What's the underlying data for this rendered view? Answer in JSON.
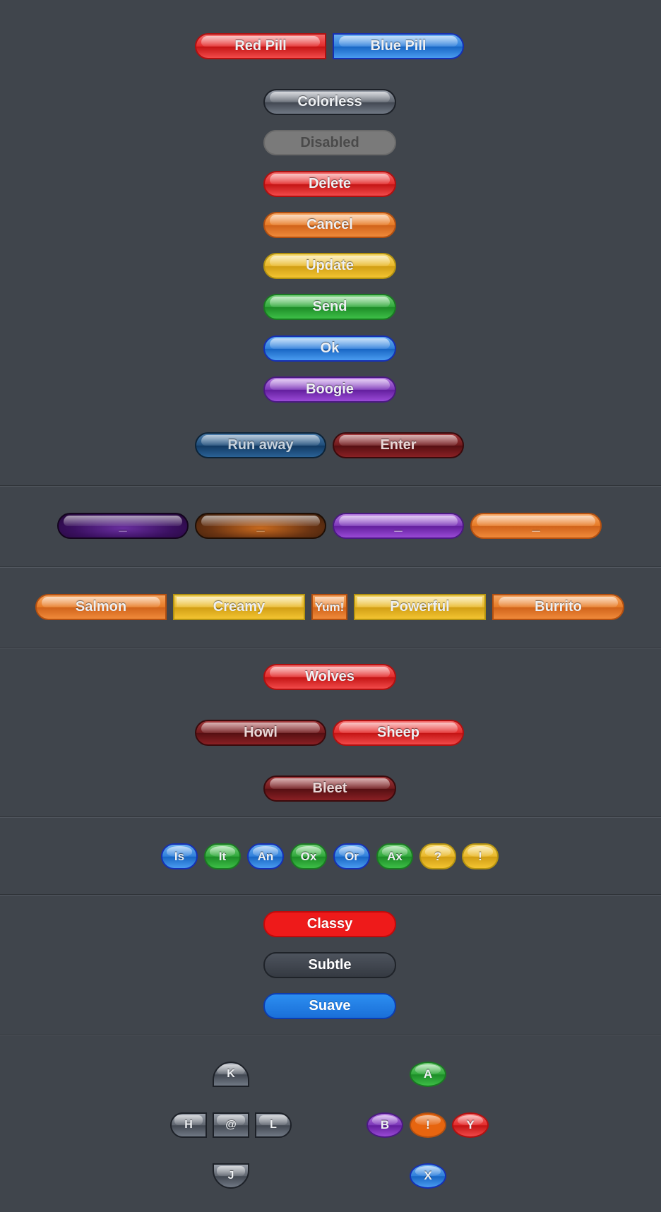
{
  "section1": {
    "red_pill": "Red Pill",
    "blue_pill": "Blue Pill",
    "colorless": "Colorless",
    "disabled": "Disabled",
    "delete": "Delete",
    "cancel": "Cancel",
    "update": "Update",
    "send": "Send",
    "ok": "Ok",
    "boogie": "Boogie",
    "run_away": "Run away",
    "enter": "Enter"
  },
  "section2": {
    "buttons": [
      "_",
      "_",
      "_",
      "_"
    ]
  },
  "section3": {
    "buttons": [
      "Salmon",
      "Creamy",
      "Yum!",
      "Powerful",
      "Burrito"
    ]
  },
  "section4": {
    "wolves": "Wolves",
    "howl": "Howl",
    "sheep": "Sheep",
    "bleet": "Bleet"
  },
  "section5": {
    "bubbles": [
      "Is",
      "It",
      "An",
      "Ox",
      "Or",
      "Ax",
      "?",
      "!"
    ]
  },
  "section6": {
    "classy": "Classy",
    "subtle": "Subtle",
    "suave": "Suave"
  },
  "section7": {
    "dpad": {
      "up": "K",
      "left": "H",
      "center": "@",
      "right": "L",
      "down": "J"
    },
    "face": {
      "top": "A",
      "left": "B",
      "center": "!",
      "right": "Y",
      "bottom": "X"
    }
  },
  "colors": {
    "background": "#40454c",
    "red": "#e32b2b",
    "blue": "#2f7fdb",
    "orange": "#e77a25",
    "yellow": "#e9b82a",
    "green": "#2fa83a",
    "purple": "#7b36b8",
    "classy_red": "#ee1a1a",
    "suave_blue": "#1a6fd8"
  }
}
